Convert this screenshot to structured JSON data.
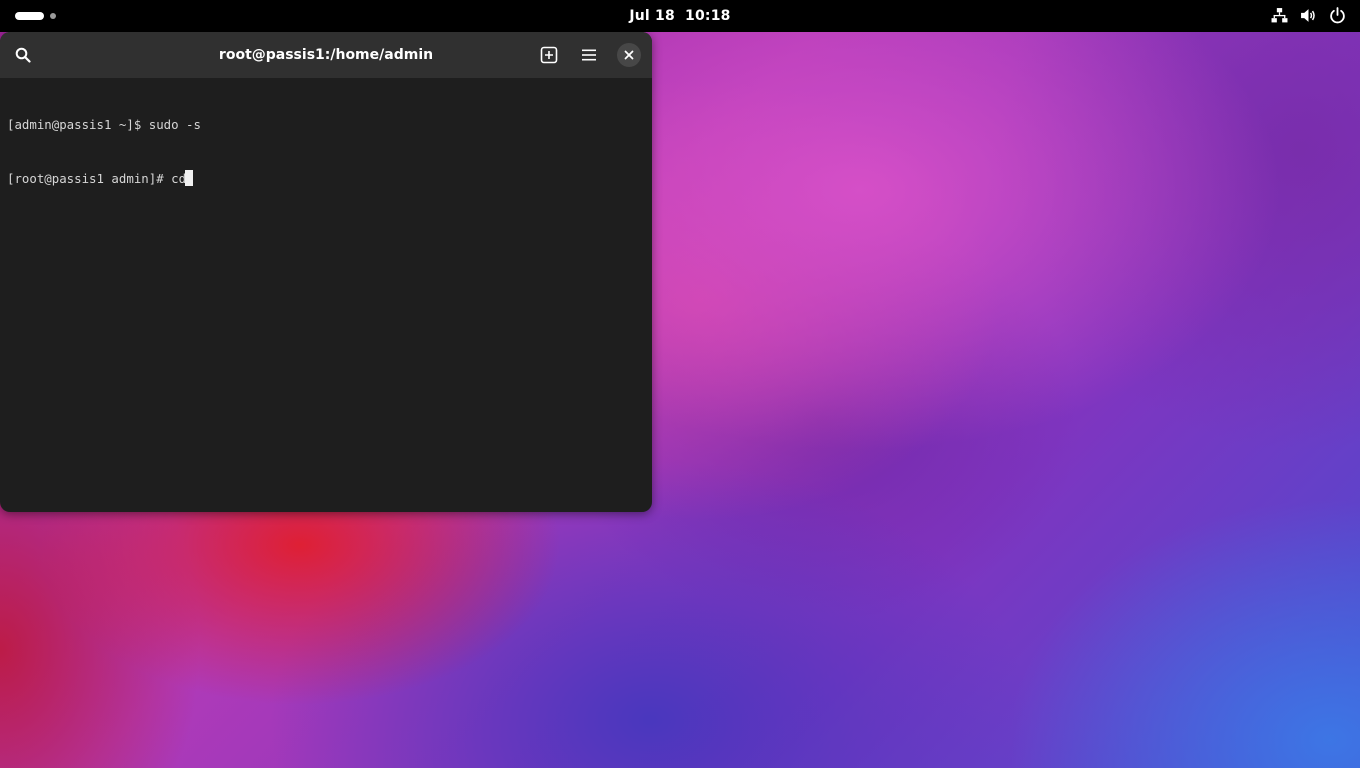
{
  "topbar": {
    "date": "Jul 18",
    "time": "10:18",
    "icons": [
      "network-wired-icon",
      "volume-icon",
      "power-icon"
    ]
  },
  "terminal": {
    "title": "root@passis1:/home/admin",
    "header_icons": [
      "search-icon",
      "new-tab-icon",
      "hamburger-menu-icon",
      "close-icon"
    ],
    "lines": [
      "[admin@passis1 ~]$ sudo -s",
      "[root@passis1 admin]# cd"
    ]
  },
  "colors": {
    "topbar_bg": "#000000",
    "terminal_bg": "#1e1e1e",
    "headerbar_bg": "#303030",
    "terminal_text": "#d6d6d6"
  }
}
